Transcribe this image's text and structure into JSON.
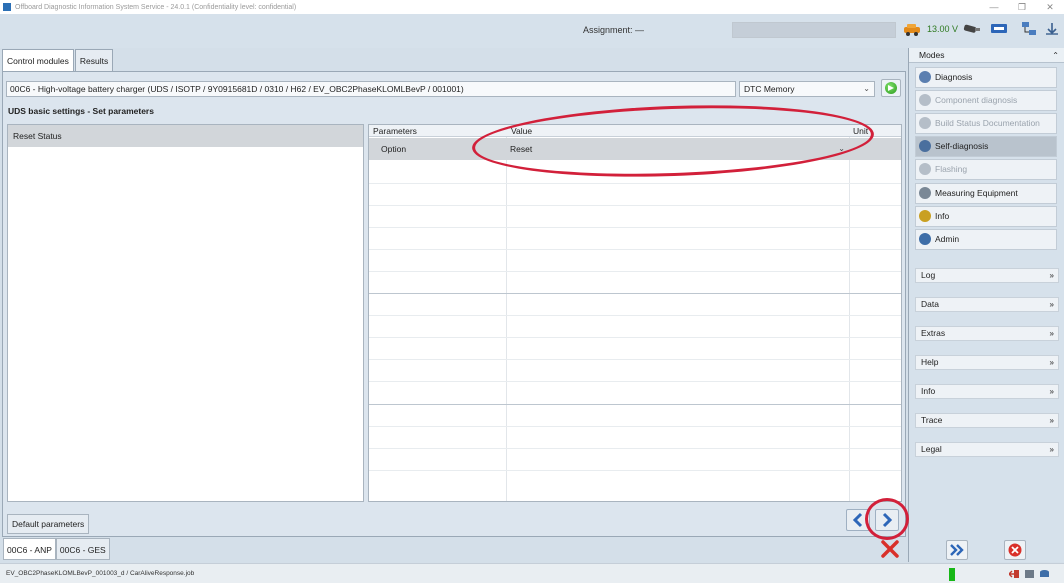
{
  "window": {
    "title": "Offboard Diagnostic Information System Service - 24.0.1 (Confidentiality level: confidential)",
    "controls": [
      "—",
      "❐",
      "✕"
    ]
  },
  "header": {
    "assignment_label": "Assignment:  —",
    "voltage": "13.00 V"
  },
  "tabs": [
    {
      "label": "Control modules",
      "active": true
    },
    {
      "label": "Results",
      "active": false
    }
  ],
  "main": {
    "ecu_field": "00C6 - High-voltage battery charger  (UDS / ISOTP / 9Y0915681D / 0310 / H62 / EV_OBC2PhaseKLOMLBevP / 001001)",
    "dtc_select": "DTC Memory",
    "section_title": "UDS basic settings - Set parameters",
    "left_list": [
      "Reset Status"
    ],
    "grid": {
      "headers": [
        "Parameters",
        "Value",
        "Unit"
      ],
      "rows": [
        {
          "parameter": "Option",
          "value": "Reset",
          "unit": ""
        }
      ]
    },
    "default_button": "Default parameters"
  },
  "bottom_tabs": [
    {
      "label": "00C6 - ANP",
      "active": true
    },
    {
      "label": "00C6 - GES",
      "active": false
    }
  ],
  "status_bar": {
    "text": "EV_OBC2PhaseKLOMLBevP_001003_d / CarAliveResponse.job"
  },
  "side_panel": {
    "modes_title": "Modes",
    "modes": [
      {
        "label": "Diagnosis",
        "state": "normal",
        "icon": "diagnosis-icon",
        "color": "#5b7fb0"
      },
      {
        "label": "Component diagnosis",
        "state": "disabled",
        "icon": "component-icon",
        "color": "#b5bec8"
      },
      {
        "label": "Build Status Documentation",
        "state": "disabled",
        "icon": "build-status-icon",
        "color": "#b5bec8"
      },
      {
        "label": "Self-diagnosis",
        "state": "selected",
        "icon": "self-diagnosis-icon",
        "color": "#4a6f9e"
      },
      {
        "label": "Flashing",
        "state": "disabled",
        "icon": "flashing-icon",
        "color": "#b5bec8"
      },
      {
        "label": "Measuring Equipment",
        "state": "normal",
        "icon": "measuring-icon",
        "color": "#7a8896"
      },
      {
        "label": "Info",
        "state": "normal",
        "icon": "info-icon",
        "color": "#c9a022"
      },
      {
        "label": "Admin",
        "state": "normal",
        "icon": "admin-icon",
        "color": "#3e6ea8"
      }
    ],
    "menus": [
      "Log",
      "Data",
      "Extras",
      "Help",
      "Info",
      "Trace",
      "Legal"
    ]
  },
  "colors": {
    "annotation_red": "#d2203a",
    "nav_blue": "#2d66b8",
    "status_green": "#17b717"
  }
}
